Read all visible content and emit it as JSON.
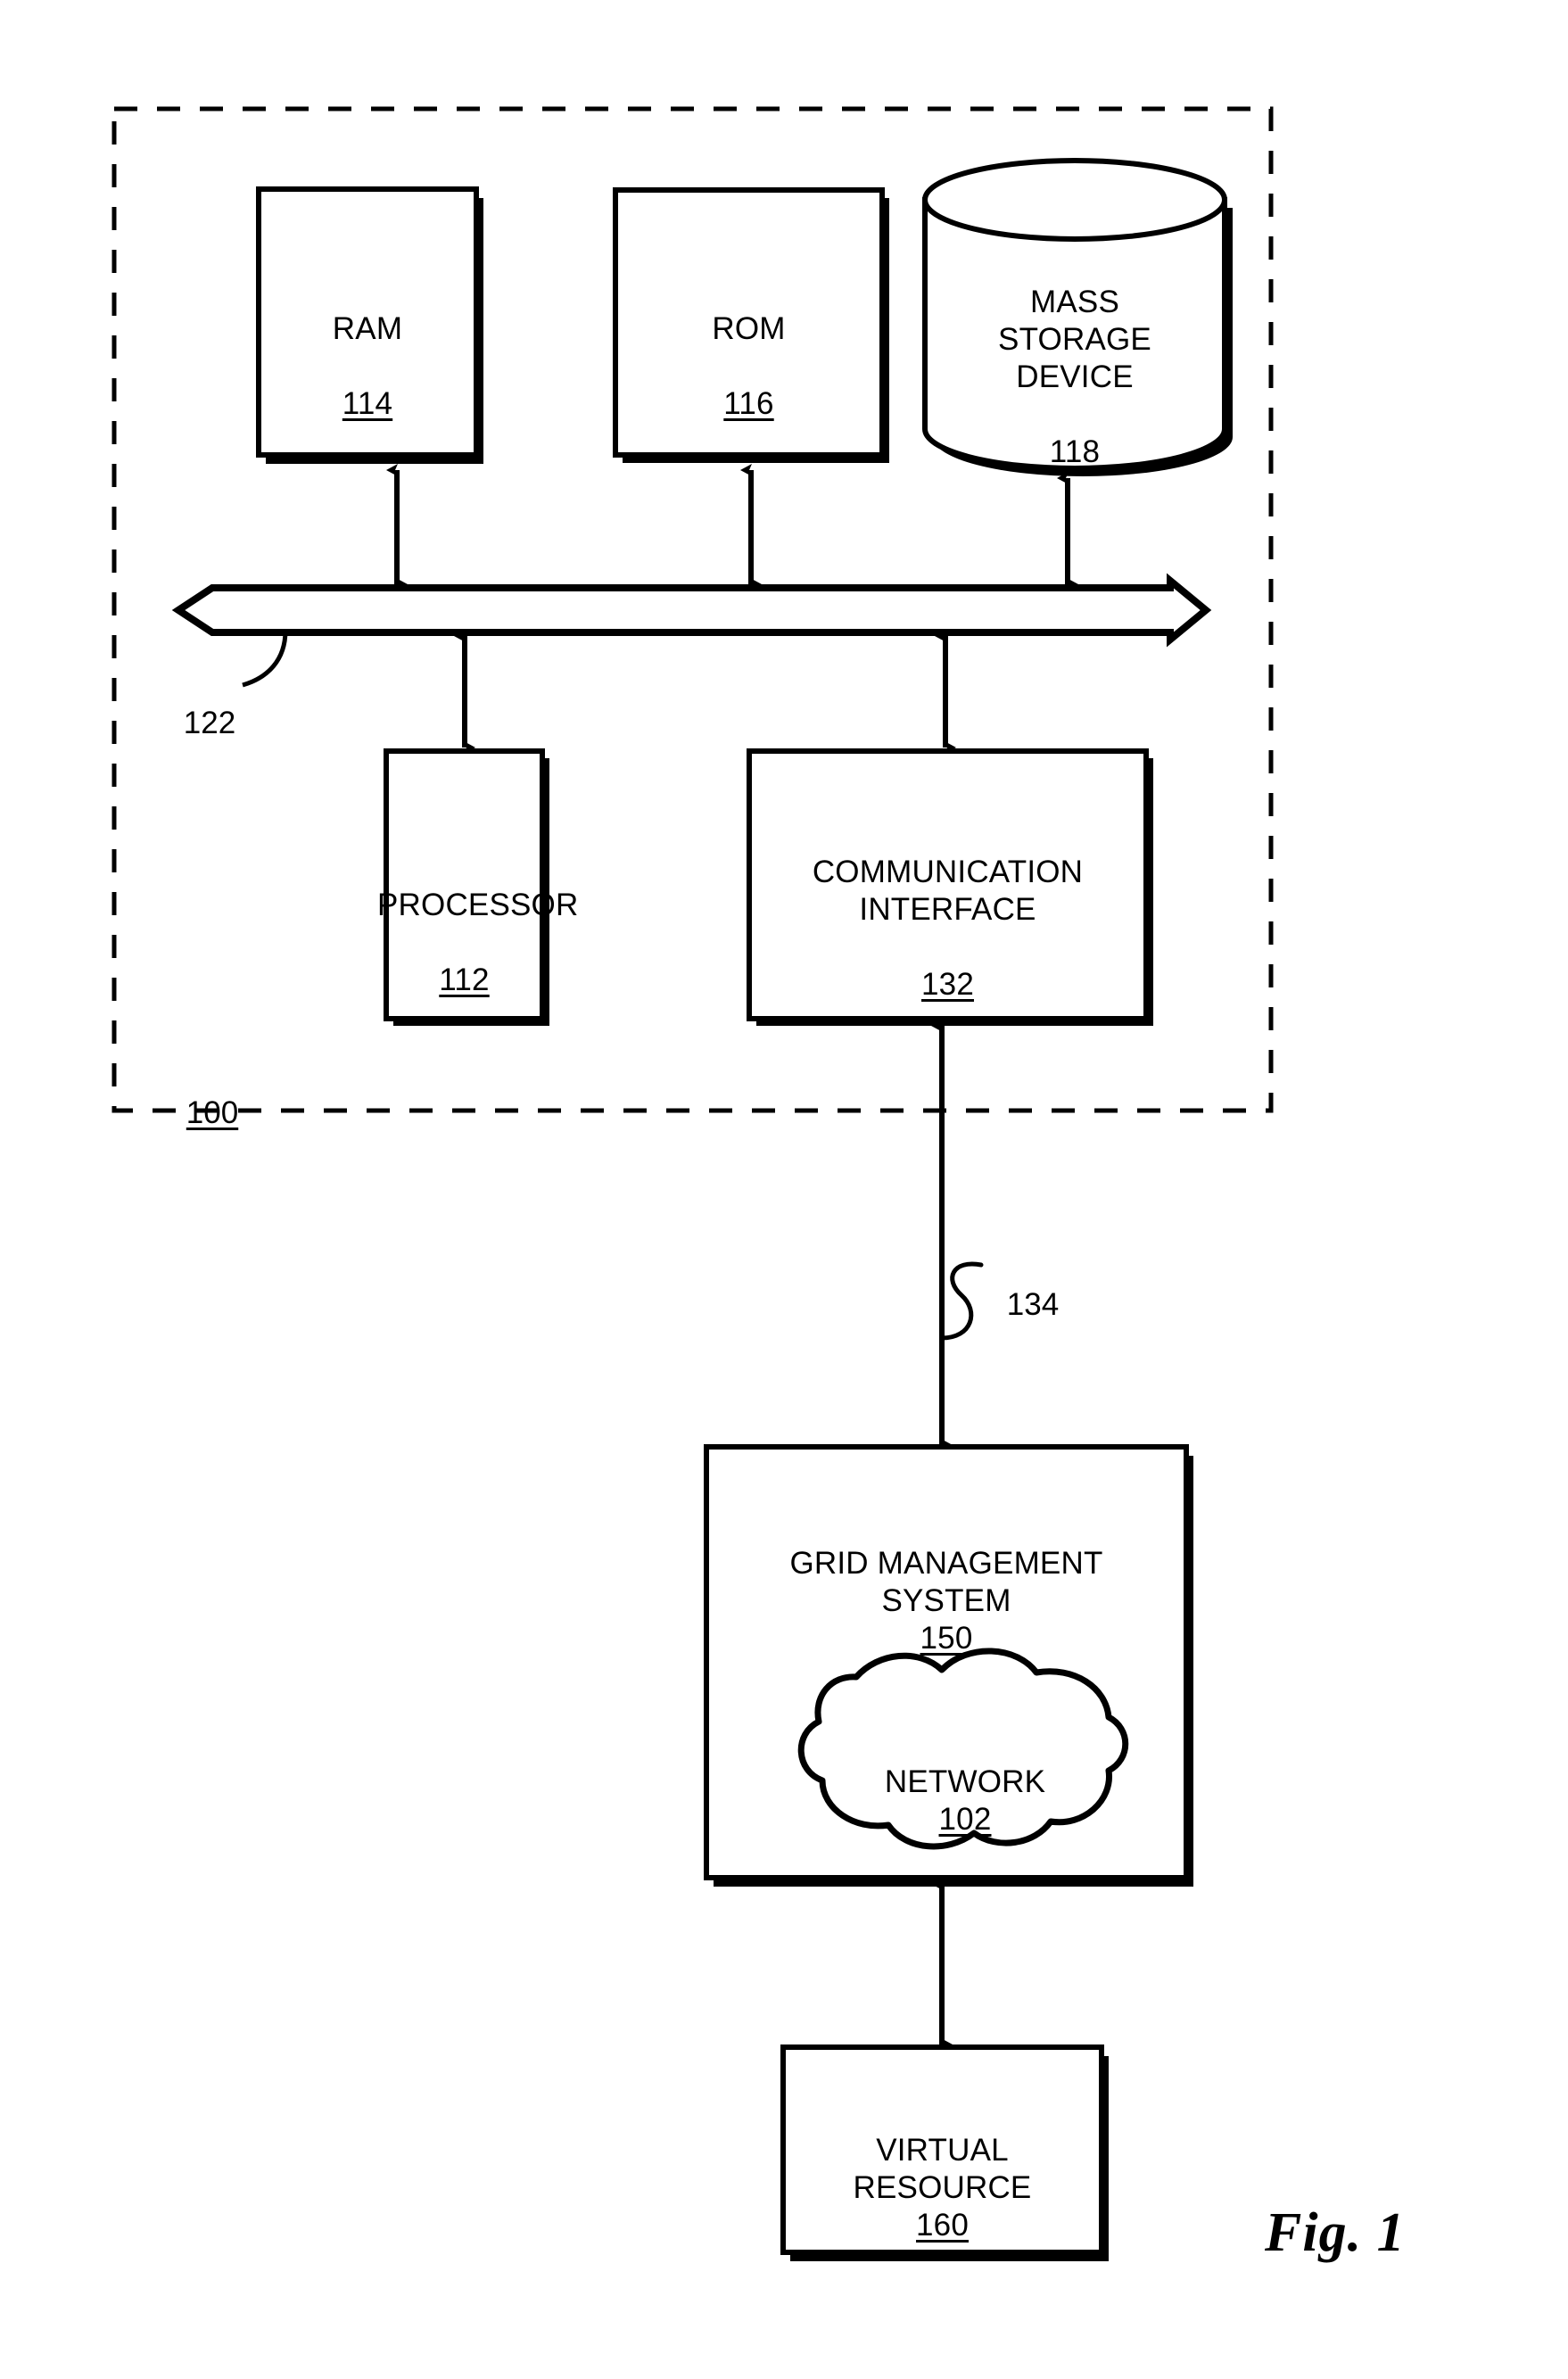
{
  "figure": {
    "caption": "Fig. 1",
    "system_ref": "100",
    "bus_ref": "122",
    "link_ref": "134"
  },
  "blocks": {
    "ram": {
      "label": "RAM",
      "ref": "114"
    },
    "rom": {
      "label": "ROM",
      "ref": "116"
    },
    "mass_storage": {
      "label": "MASS\nSTORAGE\nDEVICE",
      "ref": "118"
    },
    "processor": {
      "label": "PROCESSOR",
      "ref": "112"
    },
    "communication_interface": {
      "label": "COMMUNICATION\nINTERFACE",
      "ref": "132"
    },
    "grid_management_system": {
      "label": "GRID MANAGEMENT\nSYSTEM",
      "ref": "150"
    },
    "network": {
      "label": "NETWORK",
      "ref": "102"
    },
    "virtual_resource": {
      "label": "VIRTUAL\nRESOURCE",
      "ref": "160"
    }
  }
}
